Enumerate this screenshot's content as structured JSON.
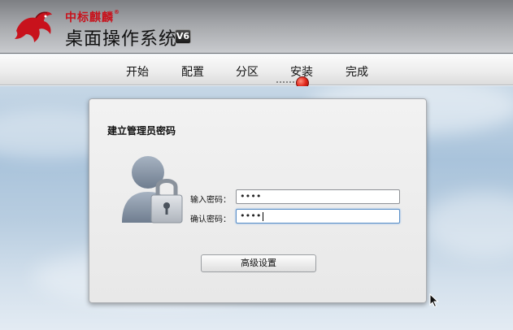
{
  "header": {
    "brand": "中标麒麟",
    "brand_mark": "®",
    "product": "桌面操作系统",
    "version_badge": "V6"
  },
  "steps": [
    {
      "label": "开始",
      "active": false
    },
    {
      "label": "配置",
      "active": false
    },
    {
      "label": "分区",
      "active": false
    },
    {
      "label": "安装",
      "active": true
    },
    {
      "label": "完成",
      "active": false
    }
  ],
  "dialog": {
    "title": "建立管理员密码",
    "password_label": "输入密码：",
    "password_value": "••••",
    "confirm_label": "确认密码：",
    "confirm_value": "••••",
    "advanced_button": "高级设置"
  },
  "colors": {
    "brand_red": "#c8121c",
    "progress_dot": "#e0261b",
    "focus_border": "#5b8fc7"
  },
  "icons": {
    "logo": "qilin-logo-icon",
    "user": "user-lock-icon",
    "cursor": "mouse-pointer-icon",
    "progress": "progress-indicator-icon"
  }
}
